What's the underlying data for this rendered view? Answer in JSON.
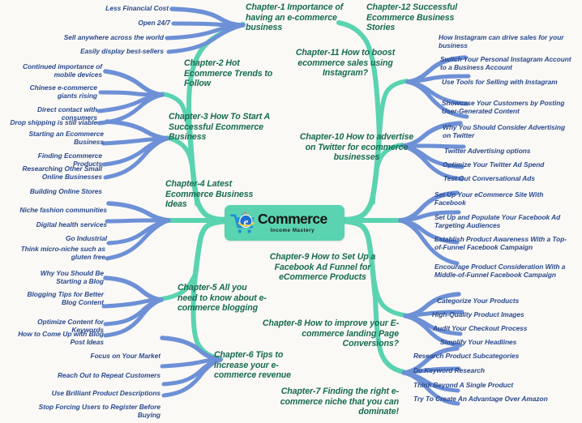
{
  "meta": {
    "title": "eCommerce Income Mastery Mind Map",
    "background_color": "#faf9f6",
    "branch_color_main": "#5ad3b0",
    "branch_color_sub": "#6d90d6",
    "chapter_text_color": "#176b51",
    "leaf_text_color": "#2b4a8e"
  },
  "center": {
    "logo_icon": "shopping-cart-with-e-icon",
    "brand_main": "Commerce",
    "brand_e": "e",
    "brand_sub": "Income Mastery"
  },
  "branches": [
    {
      "id": "ch1",
      "side": "left",
      "title": "Chapter-1 Importance of having an e-commerce business",
      "leaves": [
        "Less Financial Cost",
        "Open 24/7",
        "Sell anywhere across the world",
        "Easily display best-sellers"
      ]
    },
    {
      "id": "ch2",
      "side": "left",
      "title": "Chapter-2 Hot Ecommerce Trends to Follow",
      "leaves": [
        "Continued importance of mobile devices",
        "Chinese e-commerce giants rising",
        "Direct contact with consumers",
        "Drop shipping is still viable"
      ]
    },
    {
      "id": "ch3",
      "side": "left",
      "title": "Chapter-3 How To Start A Successful Ecommerce Business",
      "leaves": [
        "Starting an Ecommerce Business",
        "Finding Ecommerce Products",
        "Researching Other Small Online Businesses",
        "Building Online Stores"
      ]
    },
    {
      "id": "ch4",
      "side": "left",
      "title": "Chapter-4 Latest Ecommerce Business Ideas",
      "leaves": [
        "Niche fashion communities",
        "Digital health services",
        "Go Industrial",
        "Think micro-niche such as gluten free"
      ]
    },
    {
      "id": "ch5",
      "side": "left",
      "title": "Chapter-5 All you need to know about e-commerce blogging",
      "leaves": [
        "Why You Should Be Starting a Blog",
        "Blogging Tips for Better Blog Content",
        "Optimize Content for Keywords",
        "How to Come Up with Blog Post Ideas"
      ]
    },
    {
      "id": "ch6",
      "side": "left",
      "title": "Chapter-6 Tips to increase your e-commerce revenue",
      "leaves": [
        "Focus on Your Market",
        "Reach Out to Repeat Customers",
        "Use Brilliant Product Descriptions",
        "Stop Forcing Users to Register Before Buying"
      ]
    },
    {
      "id": "ch7",
      "side": "right",
      "title": "Chapter-7 Finding the right e-commerce niche that you can dominate!",
      "leaves": [
        "Research Product Subcategories",
        "Do Keyword Research",
        "Think Beyond A Single Product",
        "Try To Create An Advantage Over Amazon"
      ]
    },
    {
      "id": "ch8",
      "side": "right",
      "title": "Chapter-8 How to improve your E-commerce landing Page Conversions?",
      "leaves": [
        "Categorize Your Products",
        "High-Quality Product Images",
        "Audit Your Checkout Process",
        "Simplify Your Headlines"
      ]
    },
    {
      "id": "ch9",
      "side": "right",
      "title": "Chapter-9 How to Set Up a Facebook Ad Funnel for eCommerce Products",
      "leaves": [
        "Set Up Your eCommerce Site With Facebook",
        "Set Up and Populate Your Facebook Ad Targeting Audiences",
        "Establish Product Awareness With a Top-of-Funnel Facebook Campaign",
        "Encourage Product Consideration With a Middle-of-Funnel Facebook Campaign"
      ]
    },
    {
      "id": "ch10",
      "side": "right",
      "title": "Chapter-10 How to advertise on Twitter for ecommerce businesses",
      "leaves": [
        "Why You Should Consider Advertising on Twitter",
        "Twitter Advertising options",
        "Optimize Your Twitter Ad Spend",
        "Test Out Conversational Ads"
      ]
    },
    {
      "id": "ch11",
      "side": "right",
      "title": "Chapter-11 How to boost ecommerce sales using Instagram?",
      "leaves": [
        "How Instagram can drive sales for your business",
        "Switch Your Personal Instagram Account to a Business Account",
        "Use Tools for Selling with Instagram",
        "Showcase Your Customers by Posting User-Generated Content"
      ]
    },
    {
      "id": "ch12",
      "side": "right",
      "title": "Chapter-12 Successful Ecommerce Business Stories",
      "leaves": []
    }
  ]
}
